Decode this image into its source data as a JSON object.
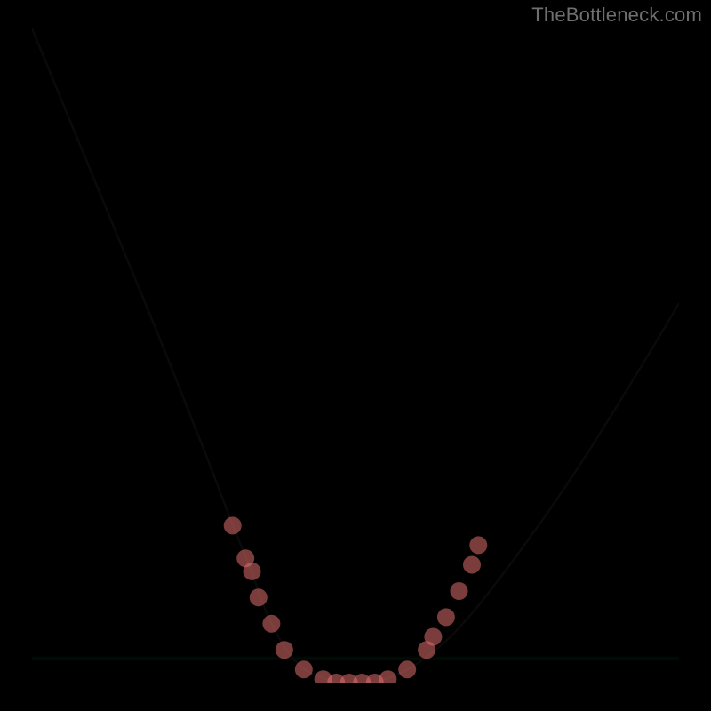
{
  "attribution": "TheBottleneck.com",
  "colors": {
    "page_bg": "#000000",
    "attribution_text": "#6f6f6f",
    "curve_stroke": "#0a0a0a",
    "dot_fill": "#e06d6d",
    "gradient_stops": [
      "#ff1440",
      "#ff6a34",
      "#ffd322",
      "#fbffb0",
      "#17d877"
    ]
  },
  "chart_data": {
    "type": "line",
    "title": "",
    "xlabel": "",
    "ylabel": "",
    "xlim": [
      0,
      100
    ],
    "ylim": [
      0,
      100
    ],
    "grid": false,
    "legend": false,
    "series": [
      {
        "name": "bottleneck-curve",
        "x": [
          0,
          5,
          10,
          15,
          20,
          24,
          28,
          31,
          34,
          36,
          38,
          40,
          42,
          44,
          47,
          50,
          53,
          56,
          60,
          66,
          74,
          84,
          94,
          100
        ],
        "y": [
          100,
          88,
          76,
          64,
          52,
          42,
          32,
          24,
          17,
          11,
          7,
          4,
          2,
          1,
          0,
          0,
          0,
          1,
          3,
          8,
          18,
          32,
          48,
          58
        ]
      }
    ],
    "markers": {
      "name": "highlight-dots",
      "points": [
        {
          "x": 31,
          "y": 24
        },
        {
          "x": 33,
          "y": 19
        },
        {
          "x": 34,
          "y": 17
        },
        {
          "x": 35,
          "y": 13
        },
        {
          "x": 37,
          "y": 9
        },
        {
          "x": 39,
          "y": 5
        },
        {
          "x": 42,
          "y": 2
        },
        {
          "x": 45,
          "y": 0.5
        },
        {
          "x": 47,
          "y": 0
        },
        {
          "x": 49,
          "y": 0
        },
        {
          "x": 51,
          "y": 0
        },
        {
          "x": 53,
          "y": 0
        },
        {
          "x": 55,
          "y": 0.5
        },
        {
          "x": 58,
          "y": 2
        },
        {
          "x": 61,
          "y": 5
        },
        {
          "x": 62,
          "y": 7
        },
        {
          "x": 64,
          "y": 10
        },
        {
          "x": 66,
          "y": 14
        },
        {
          "x": 68,
          "y": 18
        },
        {
          "x": 69,
          "y": 21
        }
      ]
    },
    "annotations": []
  }
}
